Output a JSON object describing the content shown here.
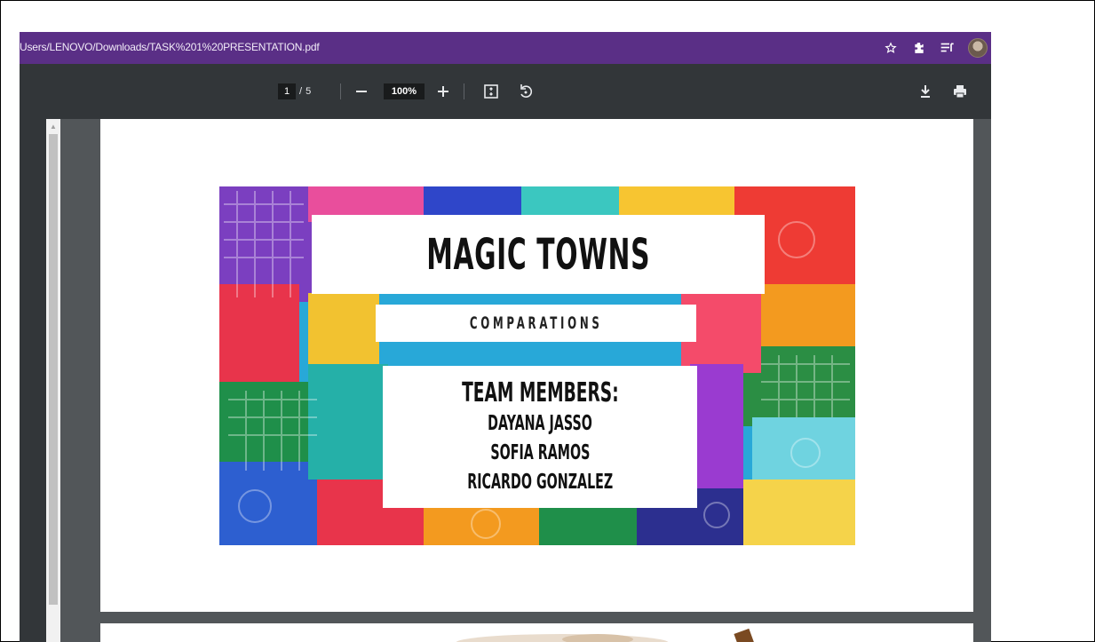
{
  "browser": {
    "url": "Users/LENOVO/Downloads/TASK%201%20PRESENTATION.pdf",
    "icons": [
      "star-icon",
      "extensions-icon",
      "reading-list-icon",
      "avatar"
    ]
  },
  "pdf_toolbar": {
    "current_page": "1",
    "page_separator": "/",
    "total_pages": "5",
    "zoom": "100%",
    "icons": [
      "zoom-out-icon",
      "zoom-in-icon",
      "fit-to-page-icon",
      "rotate-icon",
      "download-icon",
      "print-icon"
    ]
  },
  "slide": {
    "title": "MAGIC TOWNS",
    "subtitle": "COMPARATIONS",
    "team_heading": "TEAM MEMBERS:",
    "members": [
      "DAYANA JASSO",
      "SOFIA RAMOS",
      "RICARDO GONZALEZ"
    ]
  },
  "colors": {
    "url_bar": "#5a2f86",
    "toolbar": "#323639",
    "viewer_bg": "#525659"
  }
}
